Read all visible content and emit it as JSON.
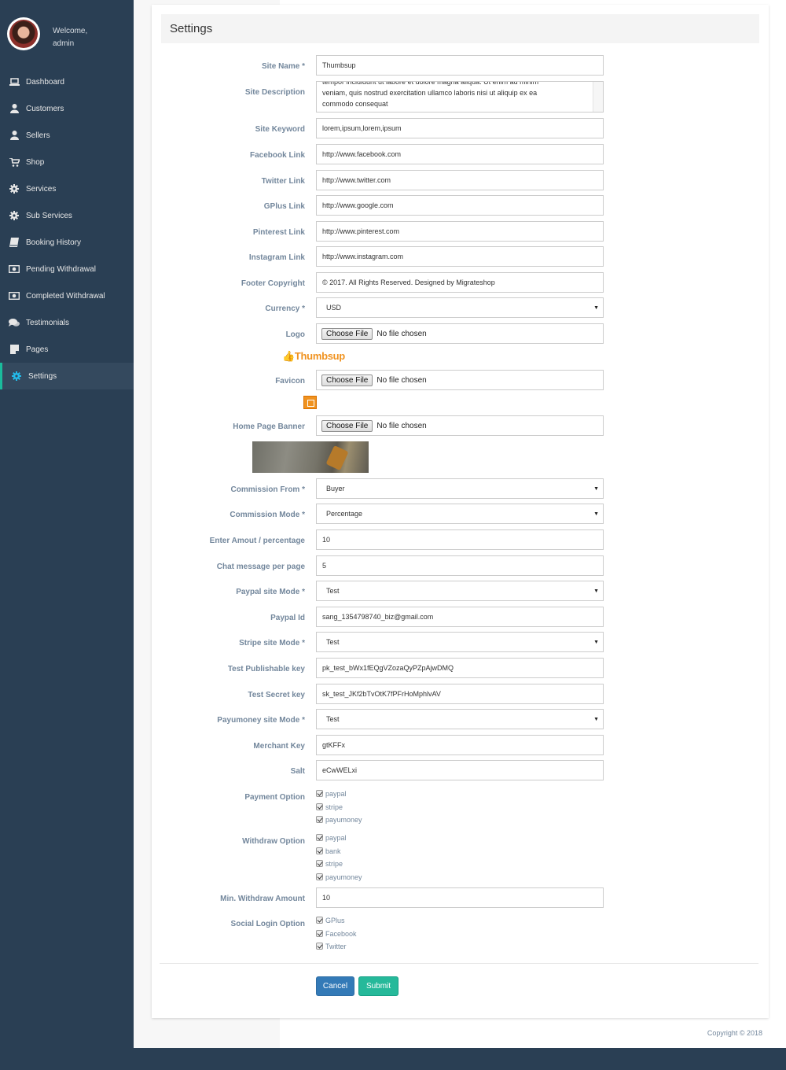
{
  "profile": {
    "welcome": "Welcome,",
    "name": "admin"
  },
  "sidebar": {
    "items": [
      {
        "label": "Dashboard",
        "icon": "laptop-icon"
      },
      {
        "label": "Customers",
        "icon": "user-icon"
      },
      {
        "label": "Sellers",
        "icon": "user-icon"
      },
      {
        "label": "Shop",
        "icon": "cart-icon"
      },
      {
        "label": "Services",
        "icon": "gear-icon"
      },
      {
        "label": "Sub Services",
        "icon": "gear-icon"
      },
      {
        "label": "Booking History",
        "icon": "book-icon"
      },
      {
        "label": "Pending Withdrawal",
        "icon": "money-icon"
      },
      {
        "label": "Completed Withdrawal",
        "icon": "money-icon"
      },
      {
        "label": "Testimonials",
        "icon": "comments-icon"
      },
      {
        "label": "Pages",
        "icon": "page-icon"
      },
      {
        "label": "Settings",
        "icon": "gear-icon",
        "active": true
      }
    ]
  },
  "panel": {
    "title": "Settings"
  },
  "form": {
    "site_name": {
      "label": "Site Name *",
      "value": "Thumbsup"
    },
    "site_description": {
      "label": "Site Description",
      "line1": "tempor incididunt ut labore et dolore magna aliqua. Ut enim ad minim",
      "line2": "veniam, quis nostrud exercitation ullamco laboris nisi ut aliquip ex ea",
      "line3": "commodo consequat"
    },
    "site_keyword": {
      "label": "Site Keyword",
      "value": "lorem,ipsum,lorem,ipsum"
    },
    "facebook_link": {
      "label": "Facebook Link",
      "value": "http://www.facebook.com"
    },
    "twitter_link": {
      "label": "Twitter Link",
      "value": "http://www.twitter.com"
    },
    "gplus_link": {
      "label": "GPlus Link",
      "value": "http://www.google.com"
    },
    "pinterest_link": {
      "label": "Pinterest Link",
      "value": "http://www.pinterest.com"
    },
    "instagram_link": {
      "label": "Instagram Link",
      "value": "http://www.instagram.com"
    },
    "footer_copyright": {
      "label": "Footer Copyright",
      "value": "© 2017. All Rights Reserved. Designed by Migrateshop"
    },
    "currency": {
      "label": "Currency *",
      "value": "USD"
    },
    "logo": {
      "label": "Logo",
      "button": "Choose File",
      "status": "No file chosen",
      "preview_text": "Thumbsup"
    },
    "favicon": {
      "label": "Favicon",
      "button": "Choose File",
      "status": "No file chosen"
    },
    "home_banner": {
      "label": "Home Page Banner",
      "button": "Choose File",
      "status": "No file chosen"
    },
    "commission_from": {
      "label": "Commission From *",
      "value": "Buyer"
    },
    "commission_mode": {
      "label": "Commission Mode *",
      "value": "Percentage"
    },
    "amount": {
      "label": "Enter Amout / percentage",
      "value": "10"
    },
    "chat_per_page": {
      "label": "Chat message per page",
      "value": "5"
    },
    "paypal_mode": {
      "label": "Paypal site Mode *",
      "value": "Test"
    },
    "paypal_id": {
      "label": "Paypal Id",
      "value": "sang_1354798740_biz@gmail.com"
    },
    "stripe_mode": {
      "label": "Stripe site Mode *",
      "value": "Test"
    },
    "test_publishable_key": {
      "label": "Test Publishable key",
      "value": "pk_test_bWx1fEQgVZozaQyPZpAjwDMQ"
    },
    "test_secret_key": {
      "label": "Test Secret key",
      "value": "sk_test_JKf2bTvOtK7fPFrHoMphlvAV"
    },
    "payumoney_mode": {
      "label": "Payumoney site Mode *",
      "value": "Test"
    },
    "merchant_key": {
      "label": "Merchant Key",
      "value": "gtKFFx"
    },
    "salt": {
      "label": "Salt",
      "value": "eCwWELxi"
    },
    "payment_option": {
      "label": "Payment Option",
      "options": [
        "paypal",
        "stripe",
        "payumoney"
      ]
    },
    "withdraw_option": {
      "label": "Withdraw Option",
      "options": [
        "paypal",
        "bank",
        "stripe",
        "payumoney"
      ]
    },
    "min_withdraw": {
      "label": "Min. Withdraw Amount",
      "value": "10"
    },
    "social_login": {
      "label": "Social Login Option",
      "options": [
        "GPlus",
        "Facebook",
        "Twitter"
      ]
    }
  },
  "buttons": {
    "cancel": "Cancel",
    "submit": "Submit"
  },
  "footer": {
    "copyright": "Copyright © 2018"
  },
  "colors": {
    "sidebar": "#2a3f54",
    "label": "#73879c",
    "primary": "#337ab7",
    "success": "#26b99a",
    "accent": "#23bbea"
  }
}
